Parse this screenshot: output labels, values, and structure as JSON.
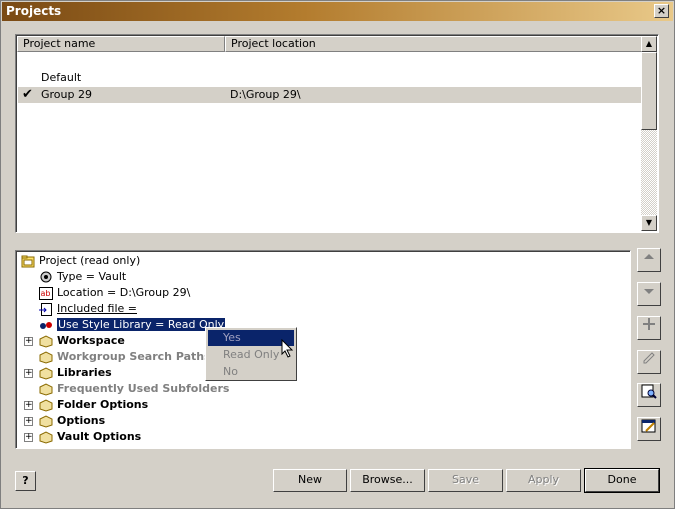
{
  "window": {
    "title": "Projects",
    "close_label": "×"
  },
  "projects_list": {
    "columns": [
      "Project name",
      "Project location"
    ],
    "rows": [
      {
        "name": "Default",
        "location": "",
        "active": false
      },
      {
        "name": "Group 29",
        "location": "D:\\Group 29\\",
        "active": true
      }
    ],
    "active_mark": "✔"
  },
  "tree": {
    "root": "Project (read only)",
    "items": [
      {
        "label": "Type = Vault",
        "icon": "vault-type-icon"
      },
      {
        "label": "Location = D:\\Group 29\\",
        "icon": "location-ab-icon"
      },
      {
        "label": "Included file =",
        "icon": "included-file-icon"
      },
      {
        "label": "Use Style Library = Read Only",
        "icon": "style-library-icon"
      }
    ],
    "groups": [
      {
        "label": "Workspace",
        "expandable": true,
        "enabled": true
      },
      {
        "label": "Workgroup Search Paths",
        "expandable": false,
        "enabled": false
      },
      {
        "label": "Libraries",
        "expandable": true,
        "enabled": true
      },
      {
        "label": "Frequently Used Subfolders",
        "expandable": false,
        "enabled": false
      },
      {
        "label": "Folder Options",
        "expandable": true,
        "enabled": true
      },
      {
        "label": "Options",
        "expandable": true,
        "enabled": true
      },
      {
        "label": "Vault Options",
        "expandable": true,
        "enabled": true
      }
    ]
  },
  "popup_menu": {
    "items": [
      "Yes",
      "Read Only",
      "No"
    ],
    "highlighted": "Yes"
  },
  "side_buttons": [
    "move-up-icon",
    "move-down-icon",
    "add-icon",
    "edit-icon",
    "find-icon",
    "properties-icon"
  ],
  "buttons": {
    "help": "?",
    "new": "New",
    "browse": "Browse...",
    "save": "Save",
    "apply": "Apply",
    "done": "Done"
  },
  "colors": {
    "title_start": "#7a4a14",
    "title_end": "#e9c989",
    "selection": "#0a246a",
    "face": "#d4d0c8"
  }
}
